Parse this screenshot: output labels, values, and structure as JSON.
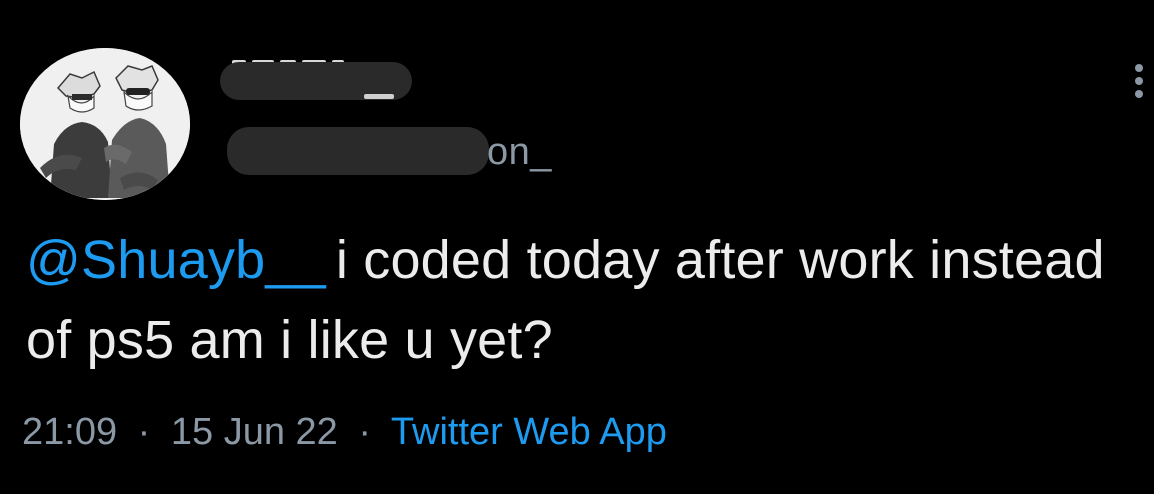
{
  "author": {
    "display_name": "",
    "handle_visible_suffix": "on_",
    "avatar_icon": "anime-characters-avatar-icon"
  },
  "menu": {
    "more_icon": "more-vertical-icon"
  },
  "tweet": {
    "mention": "@Shuayb__",
    "text": "i coded today after work instead of ps5 am i like u yet?"
  },
  "meta": {
    "time": "21:09",
    "separator": "·",
    "date": "15 Jun 22",
    "source": "Twitter Web App"
  },
  "colors": {
    "background": "#000000",
    "text": "#ececec",
    "muted": "#8b98a5",
    "link": "#1d9bf0",
    "redaction": "#2a2a2a"
  }
}
